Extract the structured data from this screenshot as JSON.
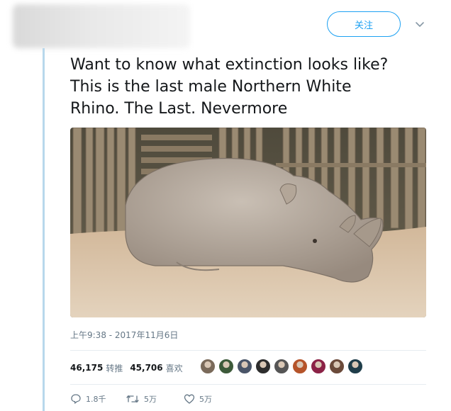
{
  "header": {
    "follow_label": "关注"
  },
  "tweet": {
    "text_lines": [
      "Want to know what extinction looks like?",
      "This is the last male Northern White",
      "Rhino. The Last. Nevermore"
    ],
    "timestamp": "上午9:38 - 2017年11月6日"
  },
  "stats": {
    "retweets_count": "46,175",
    "retweets_label": "转推",
    "likes_count": "45,706",
    "likes_label": "喜欢",
    "avatar_colors": [
      "#7a6a5a",
      "#3d5a3a",
      "#4a5568",
      "#2d2d2d",
      "#555555",
      "#b5542a",
      "#8b2246",
      "#6b4a3a",
      "#1f3d4a"
    ]
  },
  "actions": {
    "reply_count": "1.8千",
    "retweet_count": "5万",
    "like_count": "5万"
  },
  "colors": {
    "accent": "#1da1f2",
    "muted": "#657786",
    "thread": "#b8d8ec"
  }
}
